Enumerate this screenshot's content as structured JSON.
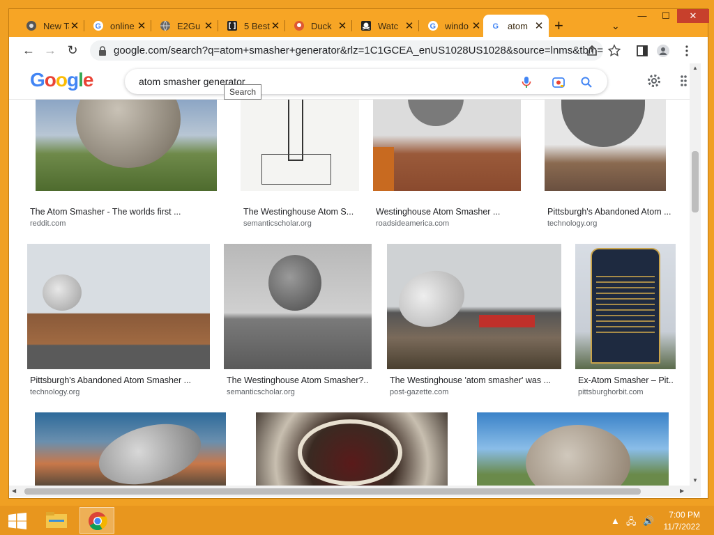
{
  "tabs": [
    {
      "title": "New Tab",
      "icon": "chrome-icon"
    },
    {
      "title": "online",
      "icon": "google-icon"
    },
    {
      "title": "E2Gu",
      "icon": "globe-icon"
    },
    {
      "title": "5 Best",
      "icon": "bracket-icon"
    },
    {
      "title": "Duck",
      "icon": "duckduckgo-icon"
    },
    {
      "title": "Watc",
      "icon": "pirate-icon"
    },
    {
      "title": "windo",
      "icon": "google-icon"
    },
    {
      "title": "atom",
      "icon": "google-icon"
    }
  ],
  "toolbar": {
    "url": "google.com/search?q=atom+smasher+generator&rlz=1C1GCEA_enUS1028US1028&source=lnms&tbm=i..."
  },
  "google": {
    "query": "atom smasher generator",
    "tooltip": "Search"
  },
  "rows": [
    [
      {
        "caption": "The Atom Smasher - The worlds first ...",
        "source": "reddit.com"
      },
      {
        "caption": "The Westinghouse Atom S...",
        "source": "semanticscholar.org"
      },
      {
        "caption": "Westinghouse Atom Smasher ...",
        "source": "roadsideamerica.com"
      },
      {
        "caption": "Pittsburgh's Abandoned Atom ...",
        "source": "technology.org"
      }
    ],
    [
      {
        "caption": "Pittsburgh's Abandoned Atom Smasher ...",
        "source": "technology.org"
      },
      {
        "caption": "The Westinghouse Atom Smasher?...",
        "source": "semanticscholar.org"
      },
      {
        "caption": "The Westinghouse 'atom smasher' was ...",
        "source": "post-gazette.com"
      },
      {
        "caption": "Ex-Atom Smasher – Pit...",
        "source": "pittsburghorbit.com"
      }
    ]
  ],
  "taskbar": {
    "time": "7:00 PM",
    "date": "11/7/2022"
  },
  "colors": {
    "window_frame": "#f7a525",
    "taskbar": "#e8961e",
    "google_blue": "#4285f4",
    "google_red": "#ea4335",
    "google_yellow": "#fbbc05",
    "google_green": "#34a853"
  }
}
